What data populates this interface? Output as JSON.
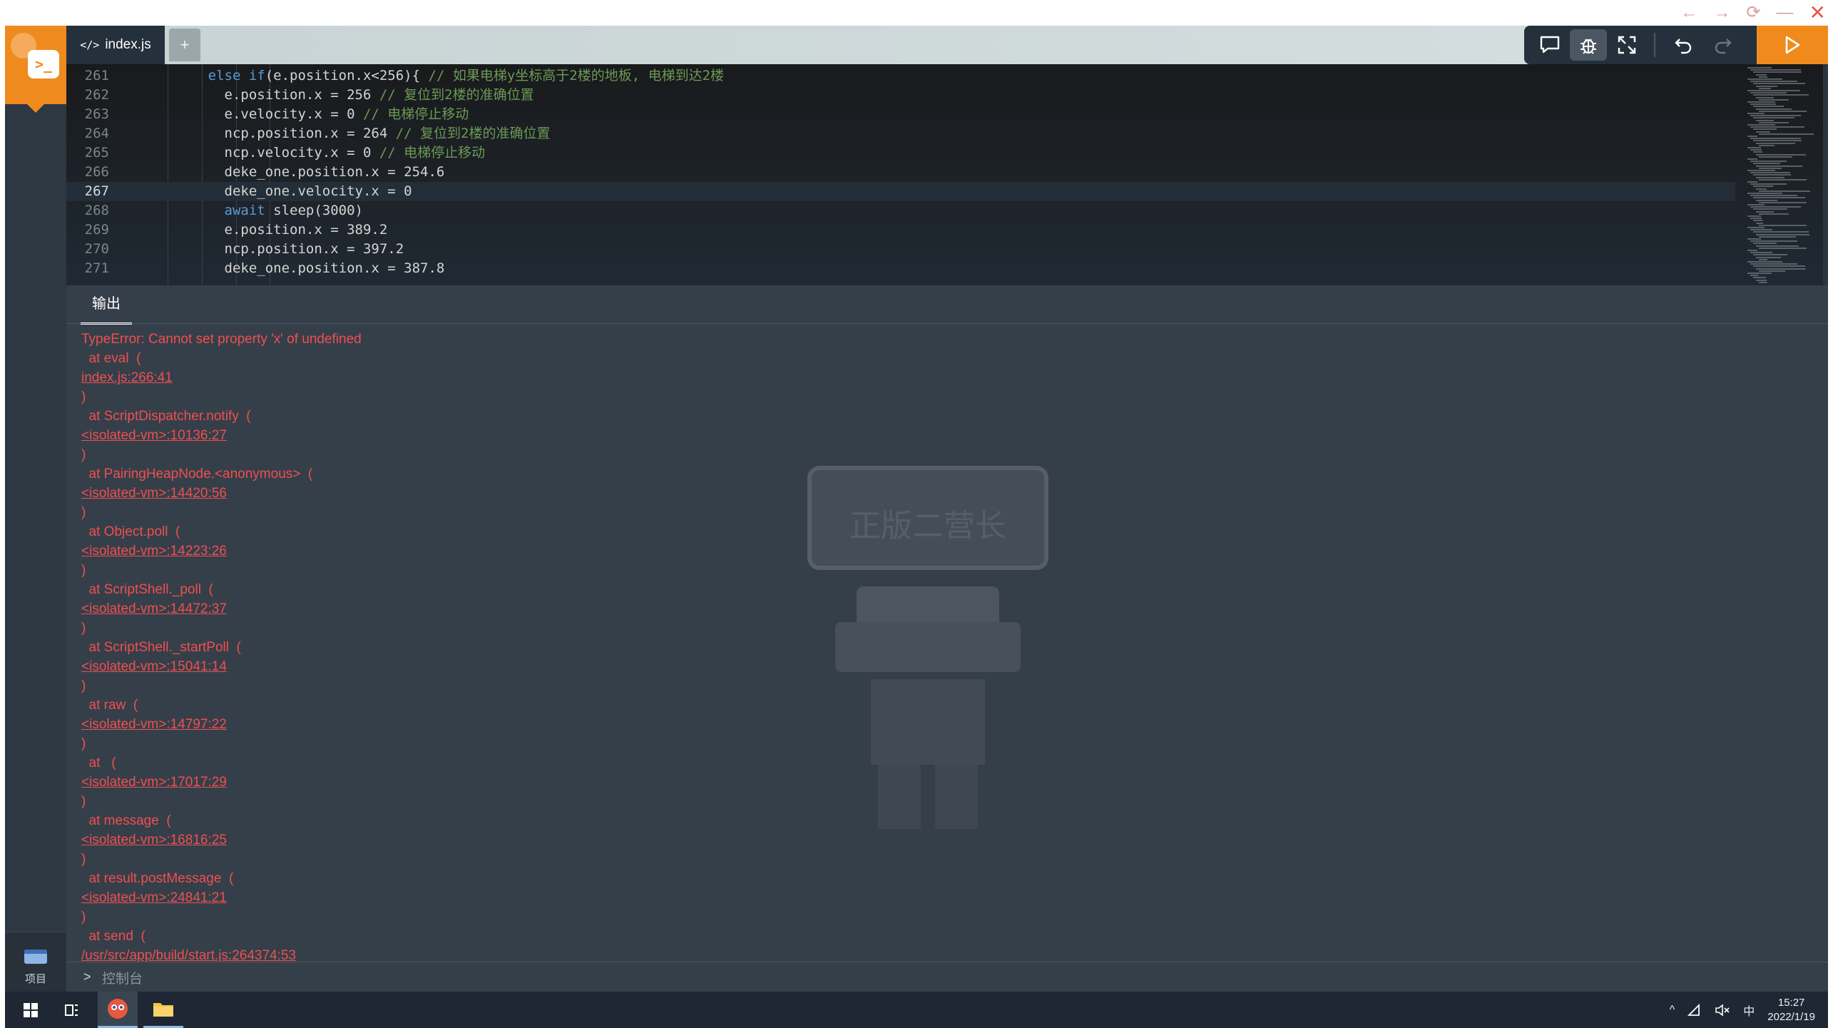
{
  "window": {
    "back": "←",
    "forward": "→",
    "reload": "⟳",
    "minimize": "—",
    "close": "✕"
  },
  "sidebar": {
    "logo_glyph": ">_",
    "project_label": "项目"
  },
  "tabs": {
    "active_label": "index.js",
    "add_label": "+"
  },
  "editor": {
    "current_line": "267",
    "lines": [
      {
        "n": "261",
        "indent": "      ",
        "kw": "else if",
        "code": "(e.position.x<256){ ",
        "comment": "// 如果电梯y坐标高于2楼的地板, 电梯到达2楼"
      },
      {
        "n": "262",
        "indent": "        ",
        "kw": "",
        "code": "e.position.x = 256 ",
        "comment": "// 复位到2楼的准确位置"
      },
      {
        "n": "263",
        "indent": "        ",
        "kw": "",
        "code": "e.velocity.x = 0 ",
        "comment": "// 电梯停止移动"
      },
      {
        "n": "264",
        "indent": "        ",
        "kw": "",
        "code": "ncp.position.x = 264 ",
        "comment": "// 复位到2楼的准确位置"
      },
      {
        "n": "265",
        "indent": "        ",
        "kw": "",
        "code": "ncp.velocity.x = 0 ",
        "comment": "// 电梯停止移动"
      },
      {
        "n": "266",
        "indent": "        ",
        "kw": "",
        "code": "deke_one.position.x = 254.6",
        "comment": ""
      },
      {
        "n": "267",
        "indent": "        ",
        "kw": "",
        "code": "deke_one.velocity.x = 0",
        "comment": ""
      },
      {
        "n": "268",
        "indent": "        ",
        "kw": "await",
        "code": " sleep(3000)",
        "comment": ""
      },
      {
        "n": "269",
        "indent": "        ",
        "kw": "",
        "code": "e.position.x = 389.2",
        "comment": ""
      },
      {
        "n": "270",
        "indent": "        ",
        "kw": "",
        "code": "ncp.position.x = 397.2",
        "comment": ""
      },
      {
        "n": "271",
        "indent": "        ",
        "kw": "",
        "code": "deke_one.position.x = 387.8",
        "comment": ""
      }
    ]
  },
  "output": {
    "tab_label": "输出",
    "watermark": "正版二营长",
    "error_lines": [
      {
        "text": "TypeError: Cannot set property 'x' of undefined",
        "link": false
      },
      {
        "text": "  at eval  (",
        "link": false
      },
      {
        "text": "index.js:266:41",
        "link": true
      },
      {
        "text": ")",
        "link": false
      },
      {
        "text": "  at ScriptDispatcher.notify  (",
        "link": false
      },
      {
        "text": "<isolated-vm>:10136:27",
        "link": true
      },
      {
        "text": ")",
        "link": false
      },
      {
        "text": "  at PairingHeapNode.<anonymous>  (",
        "link": false
      },
      {
        "text": "<isolated-vm>:14420:56",
        "link": true
      },
      {
        "text": ")",
        "link": false
      },
      {
        "text": "  at Object.poll  (",
        "link": false
      },
      {
        "text": "<isolated-vm>:14223:26",
        "link": true
      },
      {
        "text": ")",
        "link": false
      },
      {
        "text": "  at ScriptShell._poll  (",
        "link": false
      },
      {
        "text": "<isolated-vm>:14472:37",
        "link": true
      },
      {
        "text": ")",
        "link": false
      },
      {
        "text": "  at ScriptShell._startPoll  (",
        "link": false
      },
      {
        "text": "<isolated-vm>:15041:14",
        "link": true
      },
      {
        "text": ")",
        "link": false
      },
      {
        "text": "  at raw  (",
        "link": false
      },
      {
        "text": "<isolated-vm>:14797:22",
        "link": true
      },
      {
        "text": ")",
        "link": false
      },
      {
        "text": "  at   (",
        "link": false
      },
      {
        "text": "<isolated-vm>:17017:29",
        "link": true
      },
      {
        "text": ")",
        "link": false
      },
      {
        "text": "  at message  (",
        "link": false
      },
      {
        "text": "<isolated-vm>:16816:25",
        "link": true
      },
      {
        "text": ")",
        "link": false
      },
      {
        "text": "  at result.postMessage  (",
        "link": false
      },
      {
        "text": "<isolated-vm>:24841:21",
        "link": true
      },
      {
        "text": ")",
        "link": false
      },
      {
        "text": "  at send  (",
        "link": false
      },
      {
        "text": "/usr/src/app/build/start.js:264374:53",
        "link": true
      }
    ]
  },
  "console": {
    "chevron": ">",
    "label": "控制台"
  },
  "taskbar": {
    "tray_up": "^",
    "ime": "中",
    "time": "15:27",
    "date": "2022/1/19"
  },
  "colors": {
    "accent": "#f08a1d",
    "error": "#ef4f4f",
    "editor_bg": "#1d2228",
    "panel_bg": "#353f4a"
  }
}
